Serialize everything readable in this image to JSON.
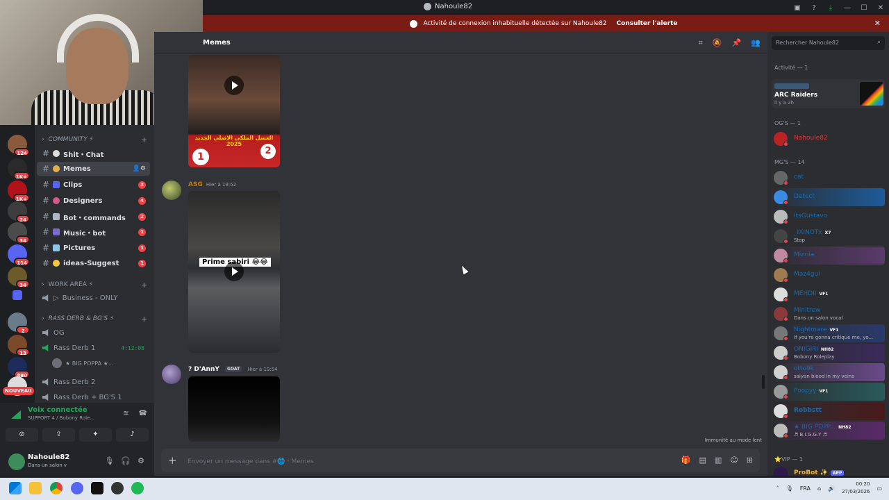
{
  "window": {
    "title": "Nahoule82"
  },
  "alert": {
    "text": "Activité de connexion inhabituelle détectée sur Nahoule82",
    "action": "Consulter l'alerte"
  },
  "servers": {
    "badges": [
      "124",
      "1K+",
      "1K+",
      "24",
      "34",
      "114",
      "34",
      "2",
      "13",
      "880"
    ],
    "new_label": "NOUVEAU"
  },
  "sidebar": {
    "categories": {
      "community": "COMMUNITY ⚡",
      "work": "WORK AREA ⚡",
      "rass": "RASS DERB & BG'S ⚡"
    },
    "channels": [
      {
        "label": "Shit・Chat"
      },
      {
        "label": "Memes"
      },
      {
        "label": "Clips",
        "count": "3"
      },
      {
        "label": "Designers",
        "count": "4"
      },
      {
        "label": "Bot・commands",
        "count": "2"
      },
      {
        "label": "Music・bot",
        "count": "1"
      },
      {
        "label": "Pictures",
        "count": "1"
      },
      {
        "label": "ideas-Suggest",
        "count": "1"
      }
    ],
    "work_channel": "Business - ONLY",
    "voice_channels": [
      {
        "label": "OG"
      },
      {
        "label": "Rass Derb 1",
        "timer": "4:12:08"
      },
      {
        "label": "Rass Derb 2"
      },
      {
        "label": "Rass Derb + BG'S 1"
      }
    ],
    "voice_user": "★ BIG POPPA ★..."
  },
  "voice_panel": {
    "status": "Voix connectée",
    "channel": "SUPPORT 4 / Bobony Role..."
  },
  "user_panel": {
    "name": "Nahoule82",
    "status": "Dans un salon v"
  },
  "chat": {
    "channel_name": "Memes",
    "messages": [
      {
        "author": "ASG",
        "time": "Hier à 19:52",
        "caption": "Prime sabiri 😂😂"
      },
      {
        "author": "? D'AnnY",
        "tag": "GOAT",
        "time": "Hier à 19:54"
      }
    ],
    "thumb_text": "العسل الملكي الاصلي الجديد 2025",
    "slowmode": "Immunité au mode lent",
    "composer_placeholder": "Envoyer un message dans #🌐・Memes"
  },
  "members": {
    "search_placeholder": "Rechercher Nahoule82",
    "activity_header": "Activité — 1",
    "activity": {
      "game": "ARC Raiders",
      "time": "il y a 2h",
      "logo_text": "ARC Raiders"
    },
    "og_header": "OG'S — 1",
    "og_members": [
      "Nahoule82"
    ],
    "mg_header": "MG'S — 14",
    "mg_members": [
      {
        "name": "cat"
      },
      {
        "name": "Detect"
      },
      {
        "name": "ItsGustavo"
      },
      {
        "name": "_IXINOTx",
        "tag": "X7",
        "status": "Stop"
      },
      {
        "name": "Mizrila"
      },
      {
        "name": "Maz4gui"
      },
      {
        "name": "MEHDII",
        "tag": "VF1"
      },
      {
        "name": "Minitrew",
        "status": "Dans un salon vocal"
      },
      {
        "name": "Nightmare",
        "tag": "VF1",
        "status": "If you're gonna critique me, yo..."
      },
      {
        "name": "ONIGIRI",
        "tag": "NH82",
        "status": "Bobony Roleplay"
      },
      {
        "name": "otto9k",
        "status": "saiyan blood in my veins"
      },
      {
        "name": "Poopyy",
        "tag": "VF1"
      },
      {
        "name": "Robbstt"
      },
      {
        "name": "★ BIG POPP...",
        "tag": "NH82",
        "status": "♬ B.I.G.G.Y ♬"
      }
    ],
    "vip_header": "VIP — 1",
    "vip_members": [
      {
        "name": "ProBot ✨",
        "tag": "APP"
      }
    ]
  },
  "taskbar": {
    "lang": "FRA",
    "time": "00:20",
    "date": "27/03/2026"
  }
}
